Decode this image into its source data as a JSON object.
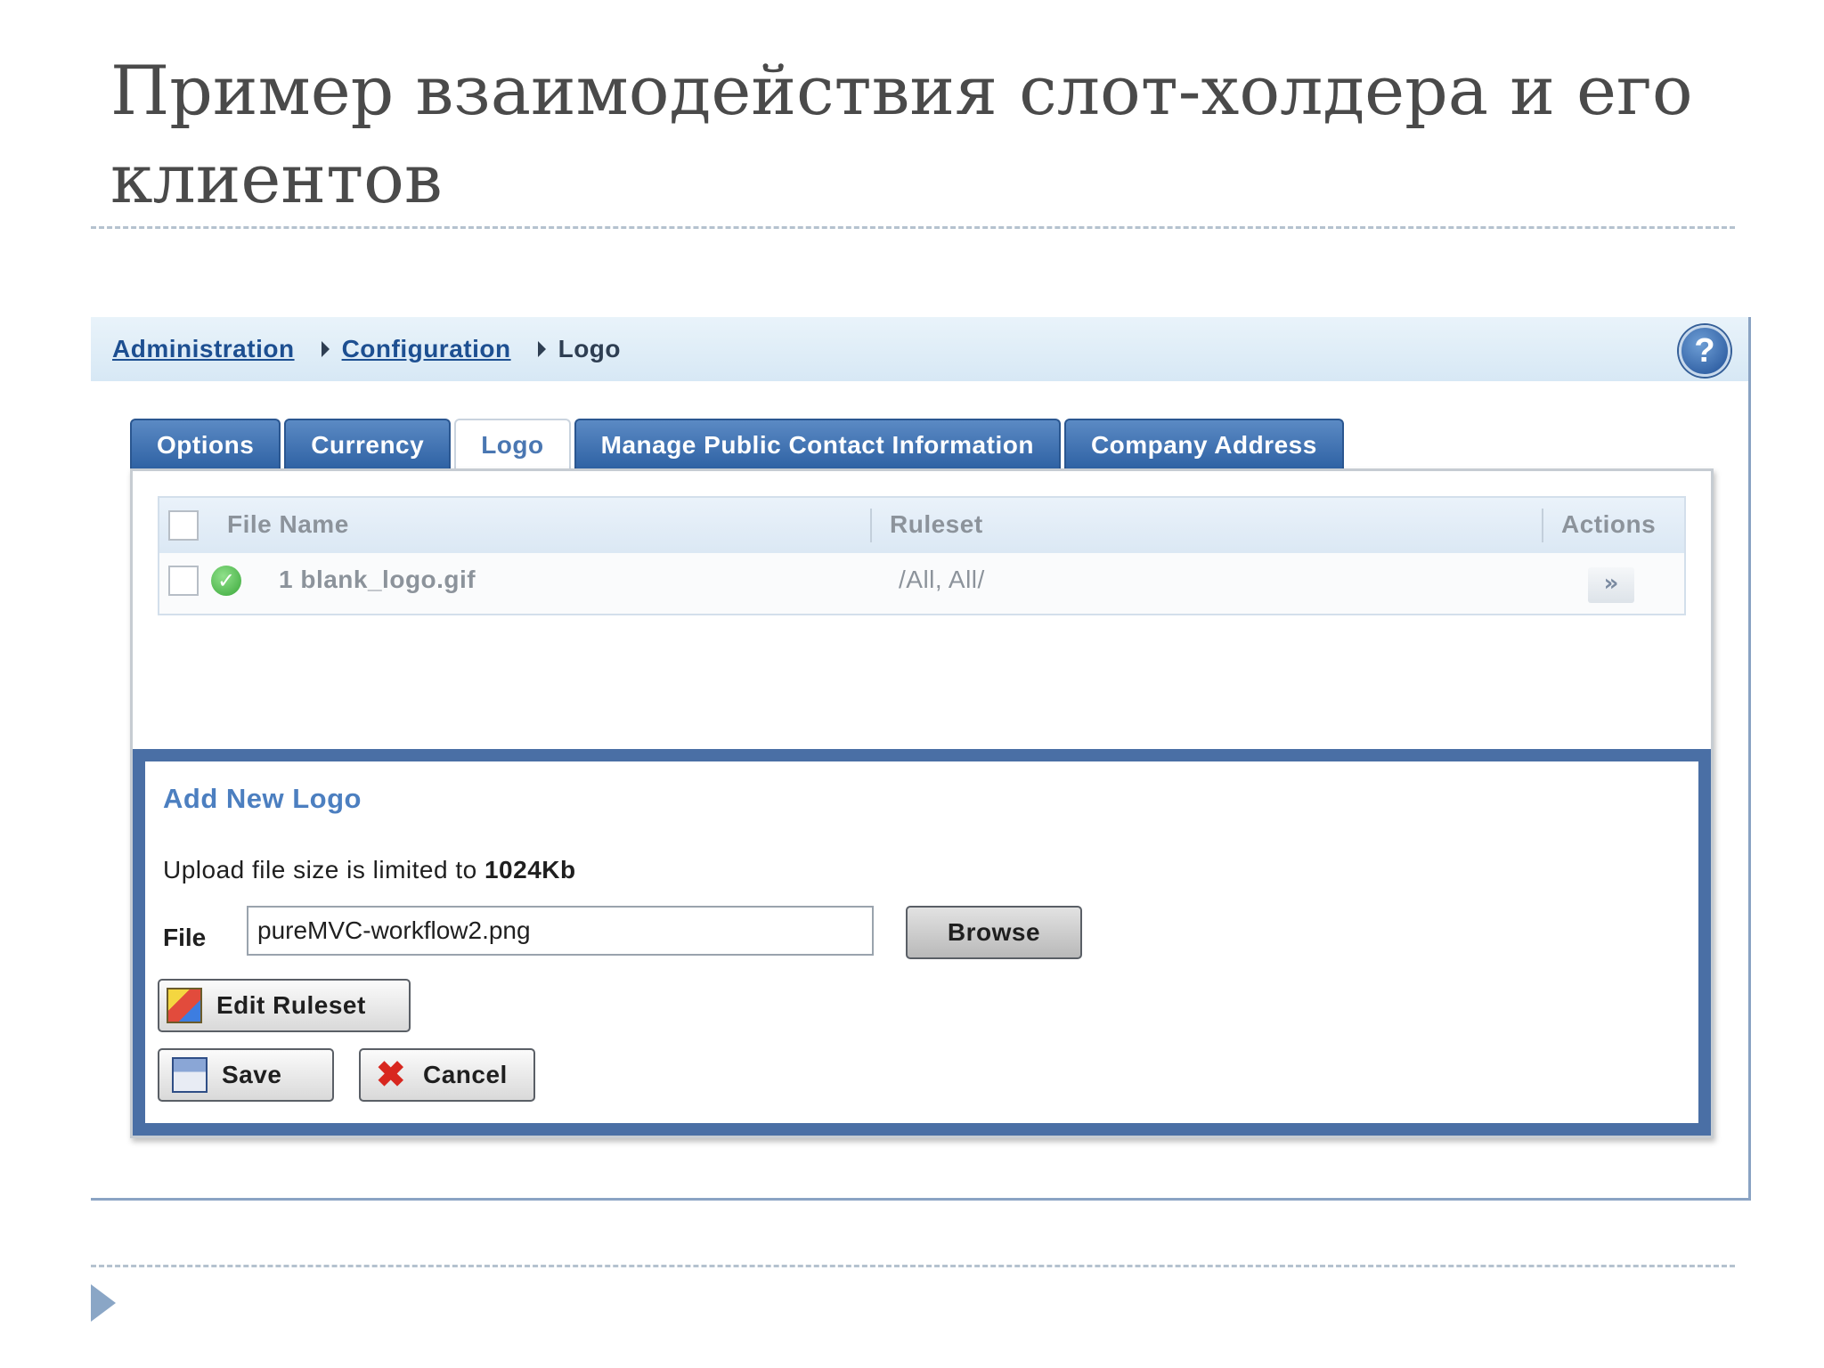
{
  "slide": {
    "title": "Пример взаимодействия слот-холдера и его клиентов"
  },
  "breadcrumb": {
    "items": [
      "Administration",
      "Configuration"
    ],
    "current": "Logo"
  },
  "tabs": [
    {
      "label": "Options",
      "active": false
    },
    {
      "label": "Currency",
      "active": false
    },
    {
      "label": "Logo",
      "active": true
    },
    {
      "label": "Manage Public Contact Information",
      "active": false
    },
    {
      "label": "Company Address",
      "active": false
    }
  ],
  "grid": {
    "columns": [
      "File Name",
      "Ruleset",
      "Actions"
    ],
    "rows": [
      {
        "file_name": "1 blank_logo.gif",
        "ruleset": "/All, All/",
        "status_icon": "check-circle-icon",
        "actions_icon": "double-chevron-down-icon"
      }
    ]
  },
  "add_logo": {
    "title": "Add New Logo",
    "upload_note_prefix": "Upload file size is limited to",
    "upload_limit": "1024Kb",
    "file_label": "File",
    "file_value": "pureMVC-workflow2.png",
    "browse_label": "Browse",
    "edit_ruleset_label": "Edit Ruleset",
    "save_label": "Save",
    "cancel_label": "Cancel"
  },
  "colors": {
    "tab_blue": "#2f62a4",
    "panel_border": "#4a6fa5",
    "link_blue": "#1d4f91"
  }
}
